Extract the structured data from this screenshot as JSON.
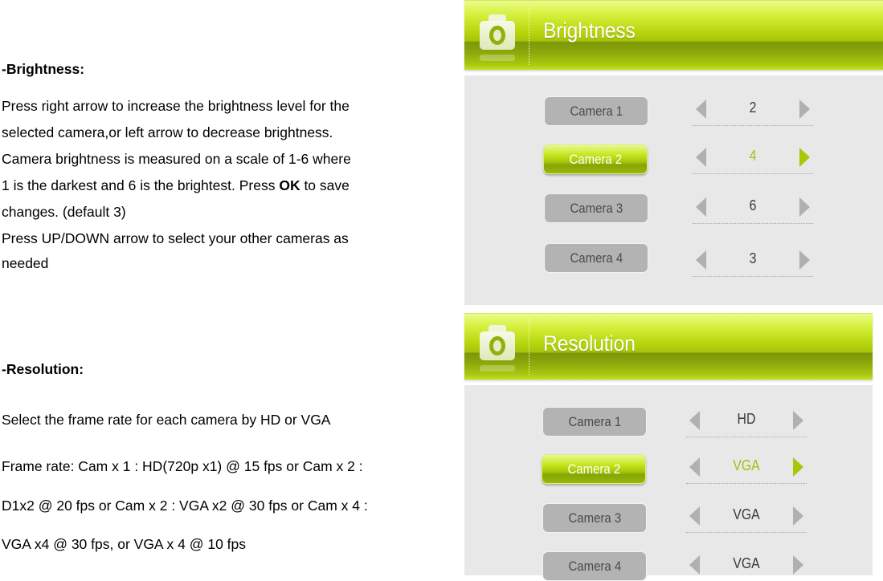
{
  "brightness_section": {
    "heading": "-Brightness:",
    "lines": [
      "Press right arrow to increase the brightness level for the",
      "selected camera,or left arrow to decrease brightness.",
      "Camera brightness is measured on a scale of 1-6 where"
    ],
    "line4_before": "1 is the darkest and 6 is the brightest. Press ",
    "line4_bold": "OK",
    "line4_after": " to save",
    "line5": "changes. (default 3)",
    "line6": "Press UP/DOWN arrow to select your other cameras as",
    "line7": "needed"
  },
  "resolution_section": {
    "heading": "-Resolution:",
    "line1": "Select the frame rate for each camera by HD or VGA",
    "line2": "Frame rate: Cam x 1 : HD(720p x1) @ 15 fps or Cam x 2 :",
    "line3": "D1x2 @ 20 fps or Cam x 2 : VGA x2 @ 30 fps or Cam x 4 :",
    "line4": "VGA x4 @ 30 fps, or VGA x 4 @ 10 fps"
  },
  "brightness_panel": {
    "title": "Brightness",
    "icon": "camera-icon",
    "accent_color": "#a6c80a",
    "selected_index": 1,
    "cameras": [
      {
        "label": "Camera 1",
        "value": "2"
      },
      {
        "label": "Camera 2",
        "value": "4"
      },
      {
        "label": "Camera 3",
        "value": "6"
      },
      {
        "label": "Camera 4",
        "value": "3"
      }
    ]
  },
  "resolution_panel": {
    "title": "Resolution",
    "icon": "camera-icon",
    "accent_color": "#a6c80a",
    "selected_index": 1,
    "cameras": [
      {
        "label": "Camera 1",
        "value": "HD"
      },
      {
        "label": "Camera 2",
        "value": "VGA"
      },
      {
        "label": "Camera 3",
        "value": "VGA"
      },
      {
        "label": "Camera 4",
        "value": "VGA"
      }
    ]
  }
}
